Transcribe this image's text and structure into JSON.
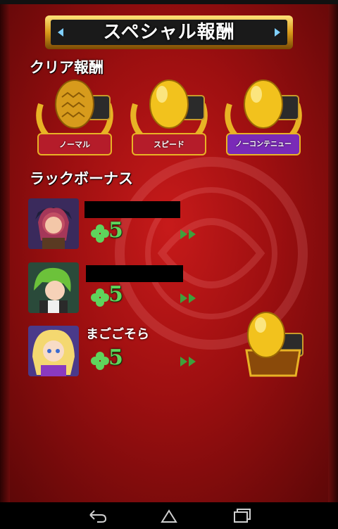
{
  "title": "スペシャル報酬",
  "clear_rewards": {
    "heading": "クリア報酬",
    "items": [
      {
        "label": "ノーマル",
        "ribbon_color": "#b51c2a"
      },
      {
        "label": "スピード",
        "ribbon_color": "#b51c2a"
      },
      {
        "label": "ノーコンテニュー",
        "ribbon_color": "#7a2ab8"
      }
    ]
  },
  "luck_bonus": {
    "heading": "ラックボーナス",
    "players": [
      {
        "name": "",
        "luck": "5"
      },
      {
        "name": "",
        "luck": "5"
      },
      {
        "name": "まごごそら",
        "luck": "5"
      }
    ]
  },
  "colors": {
    "accent_gold": "#e8b325",
    "luck_green": "#5fd45c",
    "bg_red": "#9c0f10"
  },
  "icons": [
    "back-icon",
    "home-icon",
    "recent-apps-icon",
    "clover-icon",
    "double-arrow-icon",
    "egg-icon"
  ]
}
